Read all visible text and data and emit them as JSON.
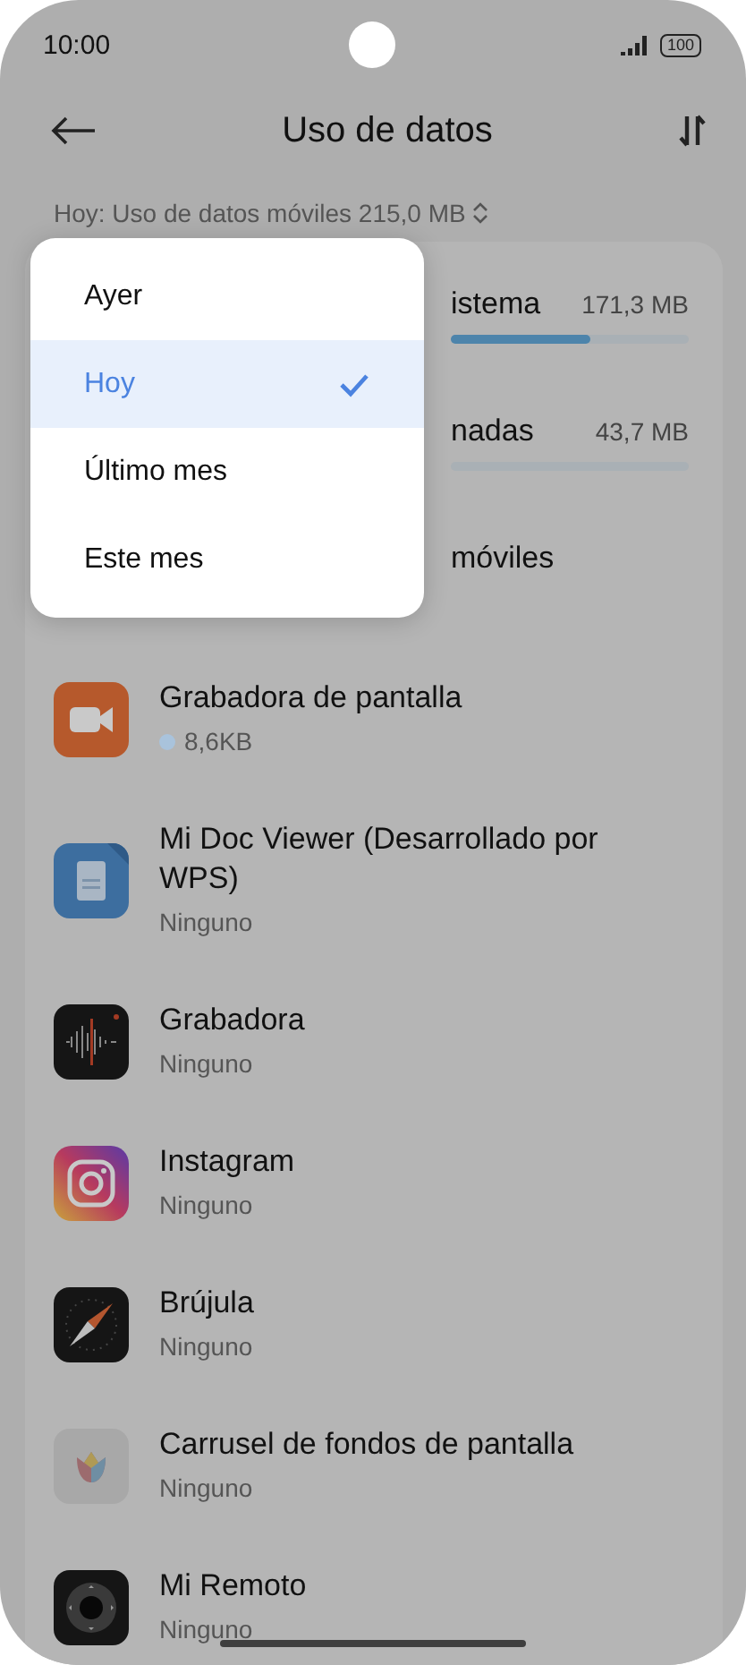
{
  "status_bar": {
    "time": "10:00",
    "battery": "100"
  },
  "header": {
    "title": "Uso de datos"
  },
  "summary": "Hoy: Uso de datos móviles 215,0 MB",
  "categories": [
    {
      "name": "istema",
      "usage": "171,3 MB",
      "level": 0.59
    },
    {
      "name": "nadas",
      "usage": "43,7 MB",
      "level": 0
    },
    {
      "name": "móviles"
    }
  ],
  "apps": [
    {
      "name": "Grabadora de pantalla",
      "usage": "8,6KB",
      "indicator": true,
      "kind": "screen-recorder"
    },
    {
      "name": "Mi Doc Viewer (Desarrollado por WPS)",
      "usage": "Ninguno",
      "indicator": false,
      "kind": "document"
    },
    {
      "name": "Grabadora",
      "usage": "Ninguno",
      "indicator": false,
      "kind": "recorder"
    },
    {
      "name": "Instagram",
      "usage": "Ninguno",
      "indicator": false,
      "kind": "camera"
    },
    {
      "name": "Brújula",
      "usage": "Ninguno",
      "indicator": false,
      "kind": "compass"
    },
    {
      "name": "Carrusel de fondos de pantalla",
      "usage": "Ninguno",
      "indicator": false,
      "kind": "flower"
    },
    {
      "name": "Mi Remoto",
      "usage": "Ninguno",
      "indicator": false,
      "kind": "remote"
    }
  ],
  "period_menu": {
    "options": [
      {
        "label": "Ayer",
        "selected": false
      },
      {
        "label": "Hoy",
        "selected": true
      },
      {
        "label": "Último mes",
        "selected": false
      },
      {
        "label": "Este mes",
        "selected": false
      }
    ]
  }
}
